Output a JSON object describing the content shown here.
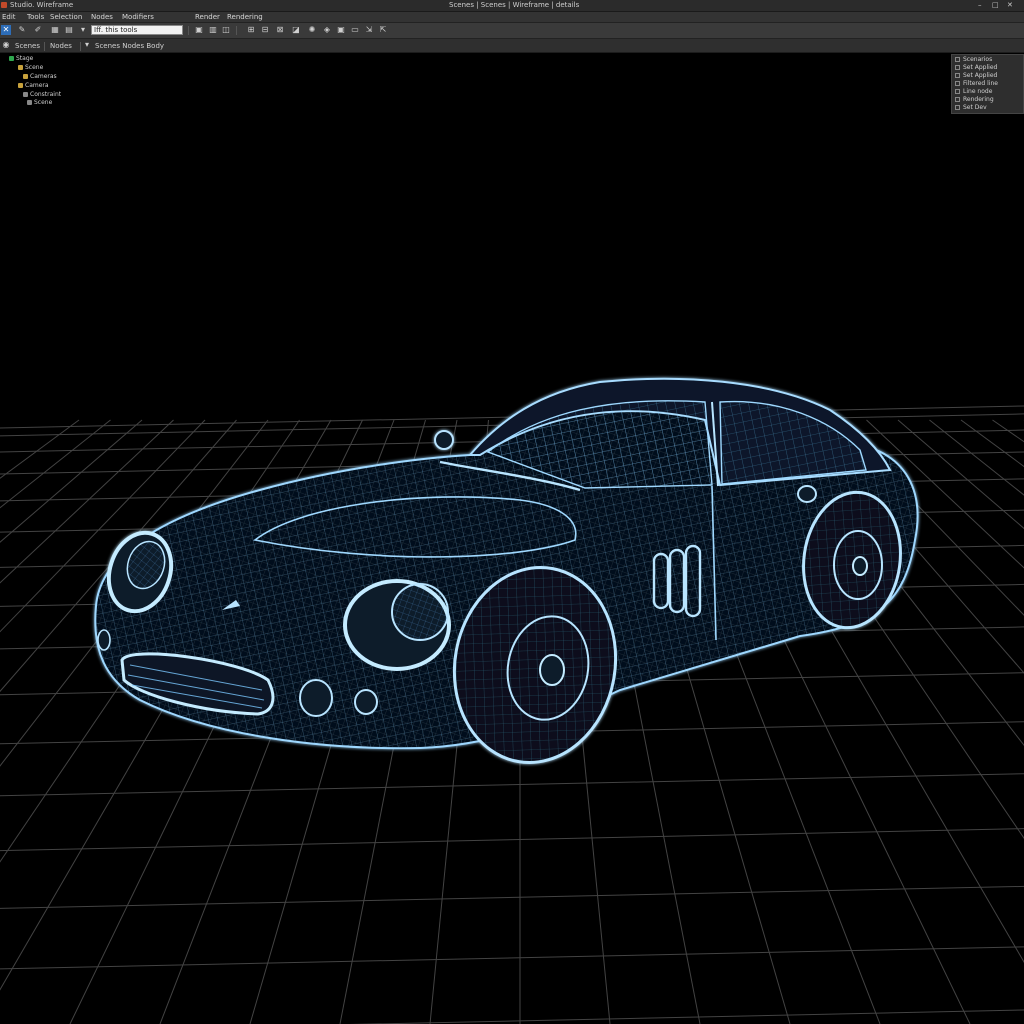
{
  "window": {
    "app_title": "Studio. Wireframe",
    "doc_title": "Scenes | Scenes | Wireframe | details",
    "controls": [
      "–",
      "□",
      "✕"
    ]
  },
  "menu": {
    "items": [
      "Edit",
      "Tools",
      "Selection",
      "Nodes",
      "Modifiers",
      "Render",
      "Rendering"
    ]
  },
  "toolbar": {
    "search_value": "Iff. this tools"
  },
  "subbar": {
    "items": [
      "Scenes",
      "Nodes",
      "Scenes Nodes Body"
    ]
  },
  "outliner": {
    "items": [
      {
        "label": "Stage",
        "color": "#2fa84f"
      },
      {
        "label": "Scene",
        "color": "#c8a23c"
      },
      {
        "label": "Cameras",
        "color": "#c8a23c"
      },
      {
        "label": "Camera",
        "color": "#c8a23c"
      },
      {
        "label": "Constraint",
        "color": "#888888"
      },
      {
        "label": "Scene",
        "color": "#888888"
      }
    ]
  },
  "properties": {
    "items": [
      "Scenarios",
      "Set Applied",
      "Set Applied",
      "Filtered line",
      "Line node",
      "Rendering",
      "Set Dev"
    ]
  },
  "colors": {
    "wire": "#7ec8ff",
    "accent": "#2d6db8"
  }
}
